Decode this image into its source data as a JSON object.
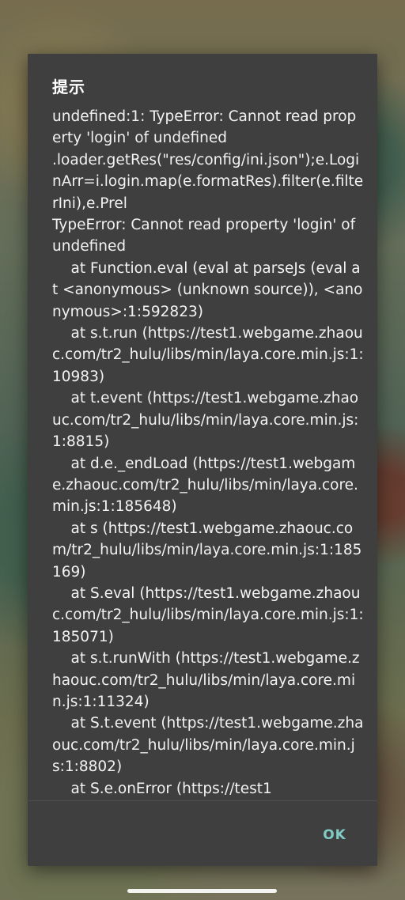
{
  "dialog": {
    "title": "提示",
    "message": "undefined:1: TypeError: Cannot read property 'login' of undefined\n.loader.getRes(\"res/config/ini.json\");e.LoginArr=i.login.map(e.formatRes).filter(e.filterIni),e.Prel\nTypeError: Cannot read property 'login' of undefined\n    at Function.eval (eval at parseJs (eval at <anonymous> (unknown source)), <anonymous>:1:592823)\n    at s.t.run (https://test1.webgame.zhaouc.com/tr2_hulu/libs/min/laya.core.min.js:1:10983)\n    at t.event (https://test1.webgame.zhaouc.com/tr2_hulu/libs/min/laya.core.min.js:1:8815)\n    at d.e._endLoad (https://test1.webgame.zhaouc.com/tr2_hulu/libs/min/laya.core.min.js:1:185648)\n    at s (https://test1.webgame.zhaouc.com/tr2_hulu/libs/min/laya.core.min.js:1:185169)\n    at S.eval (https://test1.webgame.zhaouc.com/tr2_hulu/libs/min/laya.core.min.js:1:185071)\n    at s.t.runWith (https://test1.webgame.zhaouc.com/tr2_hulu/libs/min/laya.core.min.js:1:11324)\n    at S.t.event (https://test1.webgame.zhaouc.com/tr2_hulu/libs/min/laya.core.min.js:1:8802)\n    at S.e.onError (https://test1",
    "ok_label": "OK"
  },
  "colors": {
    "dialog_background": "#3f3f3f",
    "accent": "#80cbc4",
    "text": "#f2f2f2"
  }
}
